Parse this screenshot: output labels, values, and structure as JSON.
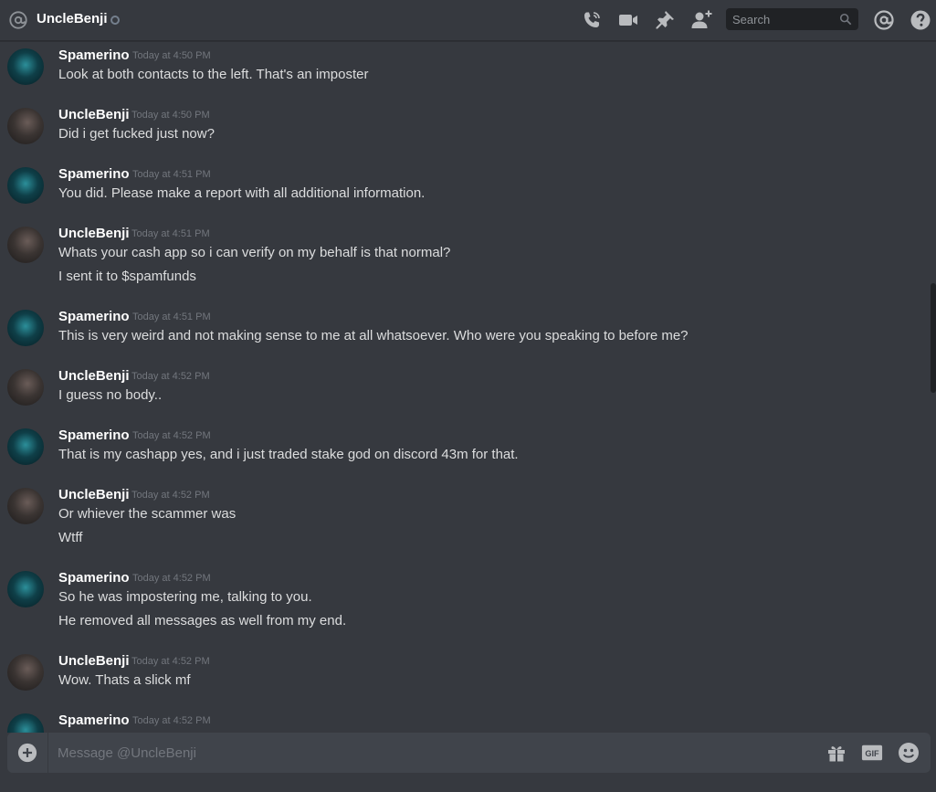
{
  "header": {
    "channel_name": "UncleBenji",
    "search_placeholder": "Search"
  },
  "icons": {
    "mention": "at-icon",
    "status": "offline-status",
    "call": "phone-call-icon",
    "video": "video-camera-icon",
    "pin": "pin-icon",
    "add_user": "add-friend-icon",
    "search": "search-icon",
    "mentions": "mentions-icon",
    "help": "help-icon",
    "add": "plus-circle-icon",
    "gift": "gift-icon",
    "gif": "gif-icon",
    "emoji": "emoji-icon"
  },
  "colors": {
    "background": "#36393f",
    "composer": "#40444b",
    "text": "#dcddde",
    "timestamp": "#72767d",
    "username": "#ffffff"
  },
  "messages": [
    {
      "author": "Spamerino",
      "time": "Today at 4:50 PM",
      "lines": [
        "Look at both contacts to the left. That's an imposter"
      ]
    },
    {
      "author": "UncleBenji",
      "time": "Today at 4:50 PM",
      "lines": [
        "Did i get fucked just now?"
      ]
    },
    {
      "author": "Spamerino",
      "time": "Today at 4:51 PM",
      "lines": [
        "You did. Please make a report with all additional information."
      ]
    },
    {
      "author": "UncleBenji",
      "time": "Today at 4:51 PM",
      "lines": [
        "Whats your cash app so i can verify on my behalf is that normal?",
        "I sent it to $spamfunds"
      ]
    },
    {
      "author": "Spamerino",
      "time": "Today at 4:51 PM",
      "lines": [
        "This is very weird and not making sense to me at all whatsoever. Who were you speaking to before me?"
      ]
    },
    {
      "author": "UncleBenji",
      "time": "Today at 4:52 PM",
      "lines": [
        "I guess no body.."
      ]
    },
    {
      "author": "Spamerino",
      "time": "Today at 4:52 PM",
      "lines": [
        "That is my cashapp yes, and i just traded stake god on discord 43m for that."
      ]
    },
    {
      "author": "UncleBenji",
      "time": "Today at 4:52 PM",
      "lines": [
        "Or whiever the scammer was",
        "Wtff"
      ]
    },
    {
      "author": "Spamerino",
      "time": "Today at 4:52 PM",
      "lines": [
        "So he was impostering me, talking to you.",
        "He removed all messages as well from my end."
      ]
    },
    {
      "author": "UncleBenji",
      "time": "Today at 4:52 PM",
      "lines": [
        "Wow. Thats a slick mf"
      ]
    },
    {
      "author": "Spamerino",
      "time": "Today at 4:52 PM",
      "lines": []
    }
  ],
  "composer": {
    "placeholder": "Message @UncleBenji",
    "gif_label": "GIF"
  }
}
